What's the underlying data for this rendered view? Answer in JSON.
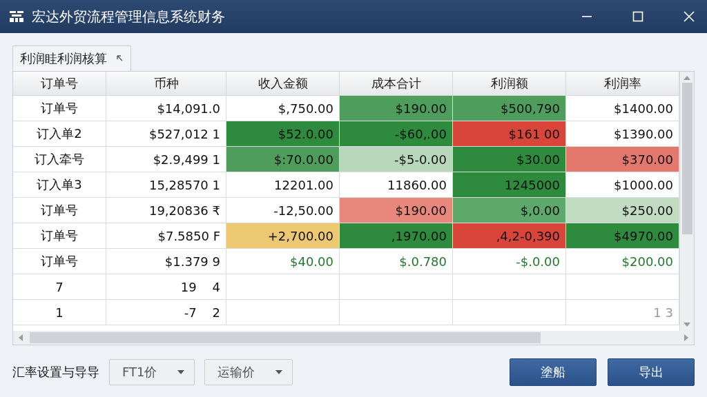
{
  "window": {
    "title": "宏达外贸流程管理信息系统财务"
  },
  "tabs": [
    {
      "label": "利润眭利润核算",
      "selected": true
    }
  ],
  "table": {
    "columns": [
      "订单号",
      "币种",
      "收入金额",
      "成本合计",
      "利润额",
      "利润率"
    ],
    "rows": [
      {
        "cells": [
          {
            "text": "订单号",
            "kind": "plain"
          },
          {
            "text": "$14,091.0",
            "kind": "plain"
          },
          {
            "text": "$,750.00",
            "kind": "plain"
          },
          {
            "text": "$190.00",
            "kind": "plain",
            "color": "#4f9d5c"
          },
          {
            "text": "$500,790",
            "kind": "plain",
            "color": "#4f9d5c"
          },
          {
            "text": "$1400.00",
            "kind": "plain"
          }
        ]
      },
      {
        "cells": [
          {
            "text": "订入单2",
            "kind": "plain"
          },
          {
            "text": "$527,012 1",
            "kind": "plain"
          },
          {
            "text": "$52.0.00",
            "kind": "plain",
            "color": "#2e8b3e"
          },
          {
            "text": "-$60,.00",
            "kind": "plain",
            "color": "#2e8b3e"
          },
          {
            "text": "$161 00",
            "kind": "plain",
            "color": "#d9453a"
          },
          {
            "text": "$1390.00",
            "kind": "plain"
          }
        ]
      },
      {
        "cells": [
          {
            "text": "订入牵号",
            "kind": "plain"
          },
          {
            "text": "$2.9,499 1",
            "kind": "plain"
          },
          {
            "text": "$:70.0.00",
            "kind": "plain",
            "color": "#4f9d5c"
          },
          {
            "text": "-$5-0.00",
            "kind": "plain",
            "color": "#b9d8bb"
          },
          {
            "text": "$30.00",
            "kind": "plain",
            "color": "#2e8b3e"
          },
          {
            "text": "$370.00",
            "kind": "plain",
            "color": "#e4786d"
          }
        ]
      },
      {
        "cells": [
          {
            "text": "订入单3",
            "kind": "plain"
          },
          {
            "text": "15,28570 1",
            "kind": "plain"
          },
          {
            "text": "12201.00",
            "kind": "plain"
          },
          {
            "text": "11860.00",
            "kind": "plain"
          },
          {
            "text": "1245000",
            "kind": "plain",
            "color": "#2e8b3e"
          },
          {
            "text": "$1000.00",
            "kind": "plain"
          }
        ]
      },
      {
        "cells": [
          {
            "text": "订单号",
            "kind": "plain"
          },
          {
            "text": "19,20836 ₹",
            "kind": "plain"
          },
          {
            "text": "-12,50.00",
            "kind": "plain"
          },
          {
            "text": "$190.00",
            "kind": "plain",
            "color": "#e8877c"
          },
          {
            "text": "$,0.00",
            "kind": "plain",
            "color": "#5fa86b"
          },
          {
            "text": "$250.00",
            "kind": "plain",
            "color": "#c2dcc2"
          }
        ]
      },
      {
        "cells": [
          {
            "text": "订单号",
            "kind": "plain"
          },
          {
            "text": "$7.5850 F",
            "kind": "plain"
          },
          {
            "text": "+2,700.00",
            "kind": "plain",
            "color": "#ecc873"
          },
          {
            "text": ",1970.00",
            "kind": "plain",
            "color": "#2e8b3e"
          },
          {
            "text": ",4,2-0,390",
            "kind": "plain",
            "color": "#d9453a"
          },
          {
            "text": "$4970.00",
            "kind": "plain",
            "color": "#2e8b3e"
          }
        ]
      },
      {
        "cells": [
          {
            "text": "订单号",
            "kind": "plain"
          },
          {
            "text": "$1.379 9",
            "kind": "plain"
          },
          {
            "text": "$40.00",
            "kind": "gain"
          },
          {
            "text": "$.0.780",
            "kind": "gain"
          },
          {
            "text": "-$.0.00",
            "kind": "gain"
          },
          {
            "text": "$200.00",
            "kind": "gain"
          }
        ]
      },
      {
        "cells": [
          {
            "text": "7",
            "kind": "plain"
          },
          {
            "text": "19    4",
            "kind": "plain"
          },
          null,
          null,
          null,
          null
        ]
      },
      {
        "cells": [
          {
            "text": "1",
            "kind": "plain"
          },
          {
            "text": "-7    2",
            "kind": "plain"
          },
          null,
          null,
          null,
          {
            "text": "1 3",
            "kind": "faint"
          }
        ]
      }
    ]
  },
  "footer": {
    "label": "汇率设置与导导",
    "dropdowns": [
      "FT1价",
      "运输价"
    ],
    "buttons": [
      "塗船",
      "导出"
    ]
  }
}
